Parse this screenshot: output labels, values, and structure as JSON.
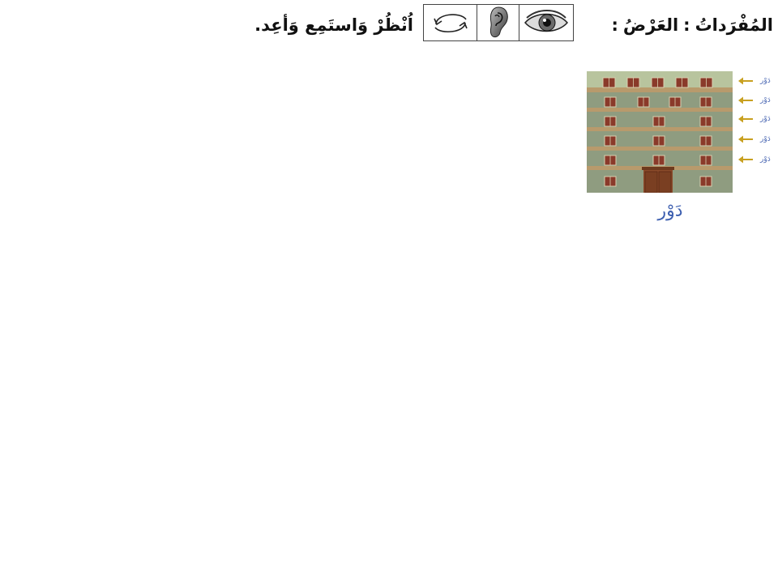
{
  "header": {
    "section_title": "المُفْرَداتُ",
    "separator": ":",
    "subsection_title": "العَرْضُ",
    "subsection_separator": ":",
    "instruction": "اُنْظُرْ وَاستَمِع وَأعِد."
  },
  "icons": [
    {
      "name": "eye-icon",
      "meaning": "look"
    },
    {
      "name": "ear-icon",
      "meaning": "listen"
    },
    {
      "name": "repeat-arrows-icon",
      "meaning": "repeat"
    }
  ],
  "figure": {
    "floor_labels": [
      "دَوْر",
      "دَوْر",
      "دَوْر",
      "دَوْر",
      "دَوْر"
    ],
    "caption": "دَوْر",
    "colors": {
      "facade": "#8f9c80",
      "roof_band": "#b8c49e",
      "floor_band": "#b89a6c",
      "window": "#8a3a2a",
      "door": "#8b4a2a",
      "arrow": "#c8a020",
      "label": "#4a67b3"
    }
  }
}
